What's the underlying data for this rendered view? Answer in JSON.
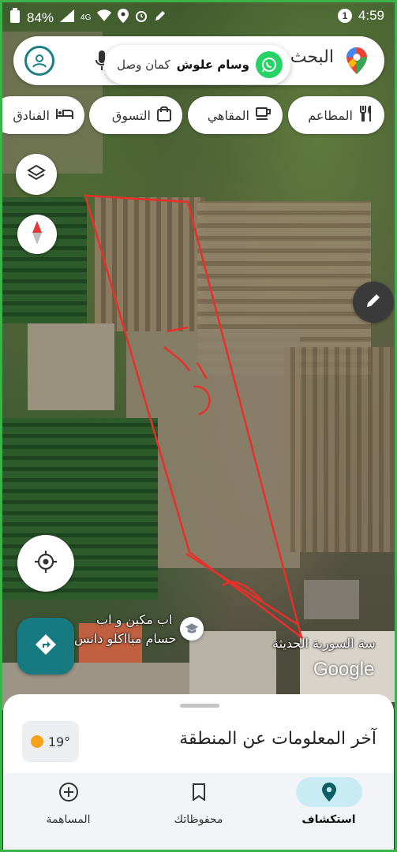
{
  "status_bar": {
    "battery": "84%",
    "network": "4G",
    "time": "4:59",
    "notification_count": "1"
  },
  "search": {
    "text": "البحث"
  },
  "notification": {
    "app_icon": "whatsapp-icon",
    "sender": "وسام علوش",
    "message": "كمان وصل"
  },
  "chips": [
    {
      "label": "المطاعم",
      "icon": "fork-knife-icon"
    },
    {
      "label": "المقاهي",
      "icon": "coffee-cup-icon"
    },
    {
      "label": "التسوق",
      "icon": "shopping-bag-icon"
    },
    {
      "label": "الفنادق",
      "icon": "bed-icon"
    }
  ],
  "map": {
    "place_label_line1": "اب مكين و اب",
    "place_label_line2": "حسام ميااكلو دانس",
    "street_label": "سة السورية الحديثة",
    "attribution": "Google",
    "annotation_color": "#e8302a"
  },
  "sheet": {
    "weather_temp": "19°",
    "title": "آخر المعلومات عن المنطقة"
  },
  "nav": [
    {
      "label": "استكشاف",
      "icon": "location-pin-icon",
      "active": true
    },
    {
      "label": "محفوظاتك",
      "icon": "bookmark-icon",
      "active": false
    },
    {
      "label": "المساهمة",
      "icon": "plus-circle-icon",
      "active": false
    }
  ],
  "colors": {
    "accent": "#1a7f84",
    "nav_active_bg": "#c9ecf4",
    "whatsapp": "#25d366",
    "frame": "#3bb34a"
  }
}
